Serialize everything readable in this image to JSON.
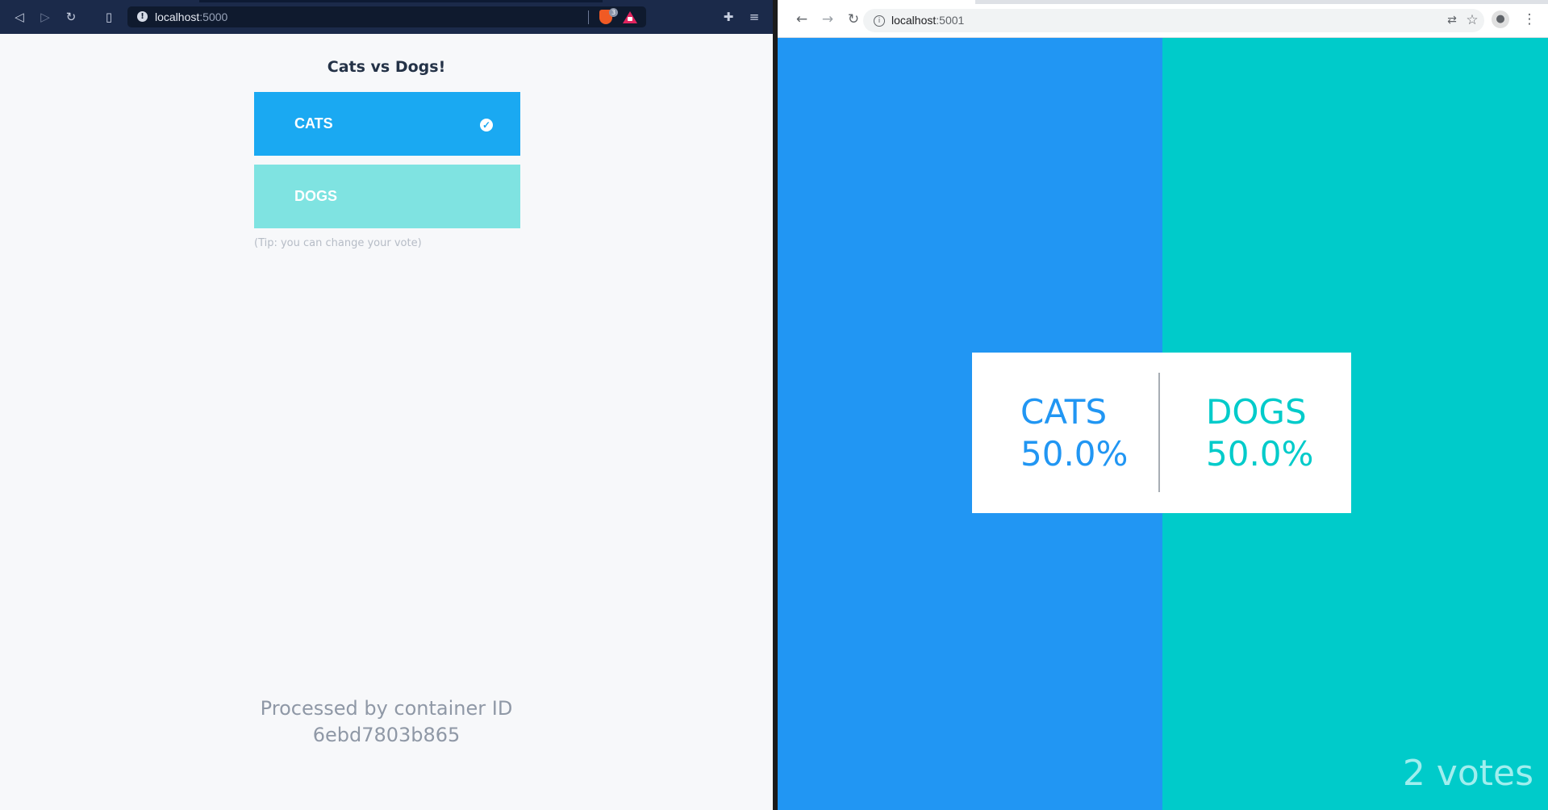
{
  "left_browser": {
    "url_host": "localhost",
    "url_port": ":5000",
    "brave_badge_count": "3"
  },
  "vote_app": {
    "title": "Cats vs Dogs!",
    "option_a": "CATS",
    "option_b": "DOGS",
    "tip": "(Tip: you can change your vote)",
    "footer_line1": "Processed by container ID",
    "footer_line2": "6ebd7803b865",
    "selected_option": "CATS"
  },
  "right_browser": {
    "url_host": "localhost",
    "url_port": ":5001"
  },
  "result_app": {
    "option_a": "CATS",
    "option_a_percent": "50.0%",
    "option_b": "DOGS",
    "option_b_percent": "50.0%",
    "votes_label": "2 votes"
  },
  "colors": {
    "cats_blue": "#2196f3",
    "dogs_teal": "#00cbca",
    "vote_cats_btn": "#1aa9f2",
    "vote_dogs_btn": "#7fe3e1",
    "brave_toolbar": "#1b2a4a"
  },
  "icons": {
    "left_toolbar": [
      "back-icon",
      "forward-icon",
      "reload-icon",
      "bookmark-icon",
      "info-icon",
      "brave-shield-icon",
      "brave-rewards-icon",
      "extensions-icon",
      "menu-icon"
    ],
    "right_toolbar": [
      "back-icon",
      "forward-icon",
      "reload-icon",
      "info-icon",
      "translate-icon",
      "star-icon",
      "profile-icon",
      "kebab-menu-icon"
    ],
    "vote_selected": "check-circle-icon"
  }
}
